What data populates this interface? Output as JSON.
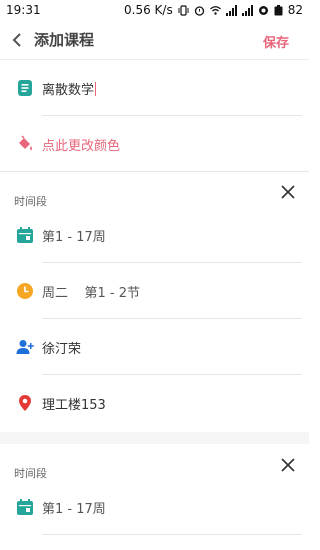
{
  "status_bar": {
    "time": "19:31",
    "speed": "0.56 K/s",
    "battery": "82"
  },
  "header": {
    "title": "添加课程",
    "save_label": "保存"
  },
  "course": {
    "name": "离散数学",
    "color_link": "点此更改颜色"
  },
  "periods": [
    {
      "label": "时间段",
      "weeks": "第1 - 17周",
      "time": "周二    第1 - 2节",
      "teacher": "徐汀荣",
      "room": "理工楼153"
    },
    {
      "label": "时间段",
      "weeks": "第1 - 17周"
    }
  ],
  "colors": {
    "accent": "#e7667a",
    "teal": "#26a69a",
    "orange": "#f5a623",
    "blue": "#1e6fd9",
    "red": "#e53935"
  }
}
